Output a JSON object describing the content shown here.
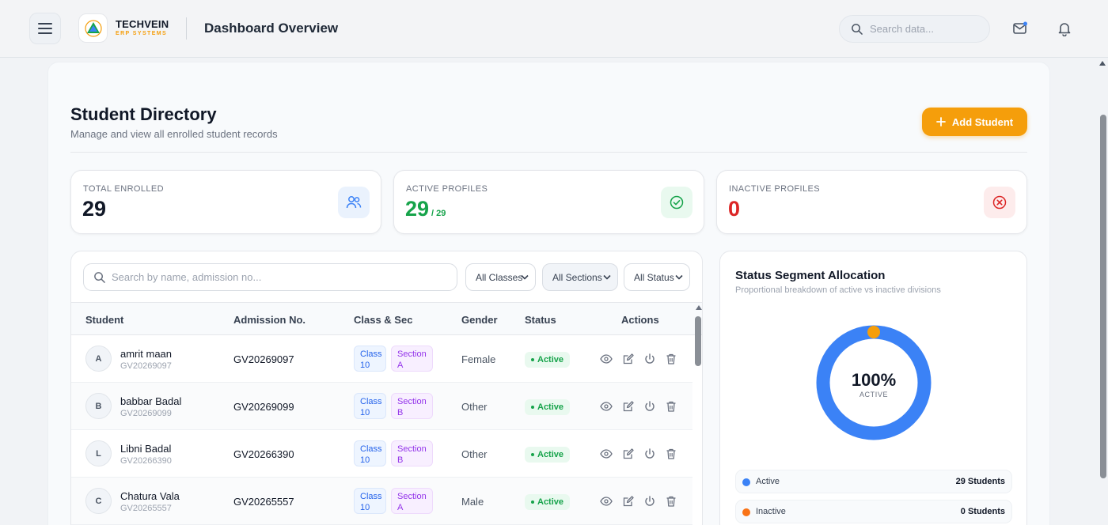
{
  "header": {
    "brand_name": "TECHVEIN",
    "brand_sub": "ERP SYSTEMS",
    "page_title": "Dashboard Overview",
    "search_placeholder": "Search data..."
  },
  "directory": {
    "title": "Student Directory",
    "subtitle": "Manage and view all enrolled student records",
    "add_button": "Add Student"
  },
  "stats": [
    {
      "label": "TOTAL ENROLLED",
      "value": "29",
      "sub": "",
      "color": "#111827"
    },
    {
      "label": "ACTIVE PROFILES",
      "value": "29",
      "sub": "/ 29",
      "color": "#16a34a"
    },
    {
      "label": "INACTIVE PROFILES",
      "value": "0",
      "sub": "",
      "color": "#dc2626"
    }
  ],
  "filters": {
    "search_placeholder": "Search by name, admission no...",
    "classes": "All Classes",
    "sections": "All Sections",
    "status": "All Status"
  },
  "table": {
    "columns": [
      "Student",
      "Admission No.",
      "Class & Sec",
      "Gender",
      "Status",
      "Actions"
    ],
    "rows": [
      {
        "initial": "A",
        "name": "amrit maan",
        "id": "GV20269097",
        "admission": "GV20269097",
        "class_line1": "Class",
        "class_line2": "10",
        "section_line1": "Section",
        "section_line2": "A",
        "gender": "Female",
        "status": "Active"
      },
      {
        "initial": "B",
        "name": "babbar Badal",
        "id": "GV20269099",
        "admission": "GV20269099",
        "class_line1": "Class",
        "class_line2": "10",
        "section_line1": "Section",
        "section_line2": "B",
        "gender": "Other",
        "status": "Active"
      },
      {
        "initial": "L",
        "name": "Libni Badal",
        "id": "GV20266390",
        "admission": "GV20266390",
        "class_line1": "Class",
        "class_line2": "10",
        "section_line1": "Section",
        "section_line2": "B",
        "gender": "Other",
        "status": "Active"
      },
      {
        "initial": "C",
        "name": "Chatura Vala",
        "id": "GV20265557",
        "admission": "GV20265557",
        "class_line1": "Class",
        "class_line2": "10",
        "section_line1": "Section",
        "section_line2": "A",
        "gender": "Male",
        "status": "Active"
      }
    ]
  },
  "status_panel": {
    "title": "Status Segment Allocation",
    "subtitle": "Proportional breakdown of active vs inactive divisions",
    "active_fraction": 1.0,
    "center_value": "100%",
    "center_label": "ACTIVE",
    "legend": [
      {
        "name": "Active",
        "value": "29 Students",
        "color": "#3b82f6"
      },
      {
        "name": "Inactive",
        "value": "0 Students",
        "color": "#f97316"
      }
    ]
  },
  "colors": {
    "accent": "#f59e0b",
    "active_blue": "#3b82f6",
    "inactive_orange": "#f97316"
  }
}
